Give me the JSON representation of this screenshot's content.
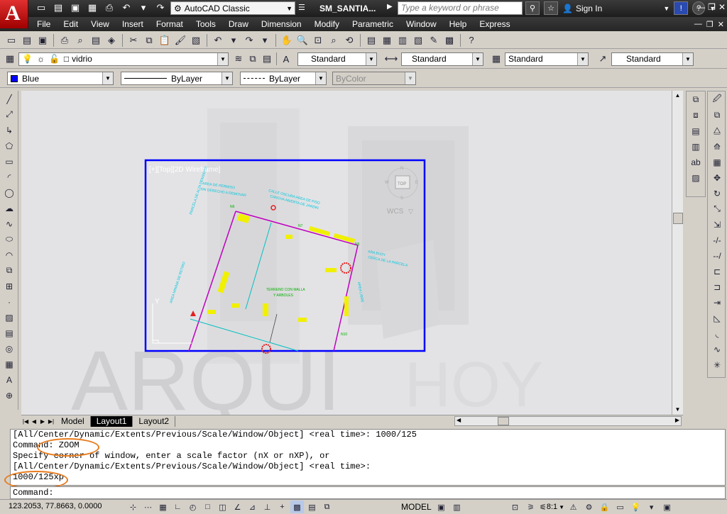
{
  "app": {
    "logo_letter": "A",
    "workspace": "AutoCAD Classic",
    "doc_title": "SM_SANTIA...",
    "search_placeholder": "Type a keyword or phrase",
    "sign_in": "Sign In"
  },
  "menu": [
    "File",
    "Edit",
    "View",
    "Insert",
    "Format",
    "Tools",
    "Draw",
    "Dimension",
    "Modify",
    "Parametric",
    "Window",
    "Help",
    "Express"
  ],
  "layers": {
    "current_layer": "vidrio",
    "text_style": "Standard",
    "dim_style": "Standard",
    "table_style": "Standard",
    "mleader_style": "Standard"
  },
  "properties": {
    "color": "Blue",
    "linetype": "ByLayer",
    "lineweight": "ByLayer",
    "plotstyle": "ByColor"
  },
  "viewport": {
    "label": "[+][Top][2D Wireframe]",
    "wcs": "WCS",
    "compass_n": "N",
    "compass_s": "S",
    "compass_e": "E",
    "compass_w": "W",
    "compass_top": "TOP",
    "border_color": "#0000ff"
  },
  "layout_tabs": [
    "Model",
    "Layout1",
    "Layout2"
  ],
  "active_tab": "Layout1",
  "command_history": [
    "[All/Center/Dynamic/Extents/Previous/Scale/Window/Object] <real time>: 1000/125",
    "Command: ZOOM",
    "Specify corner of window, enter a scale factor (nX or nXP), or",
    "[All/Center/Dynamic/Extents/Previous/Scale/Window/Object] <real time>:",
    "1000/125xp"
  ],
  "command_prompt": "Command:",
  "status": {
    "coordinates": "123.2053, 77.8663, 0.0000",
    "space": "MODEL",
    "annotation_scale": "8:1"
  },
  "colors": {
    "highlight": "#e87b1c",
    "titlebar": "#2a2a2a",
    "canvas": "#e3e3e5"
  },
  "watermark": "ARQUI"
}
